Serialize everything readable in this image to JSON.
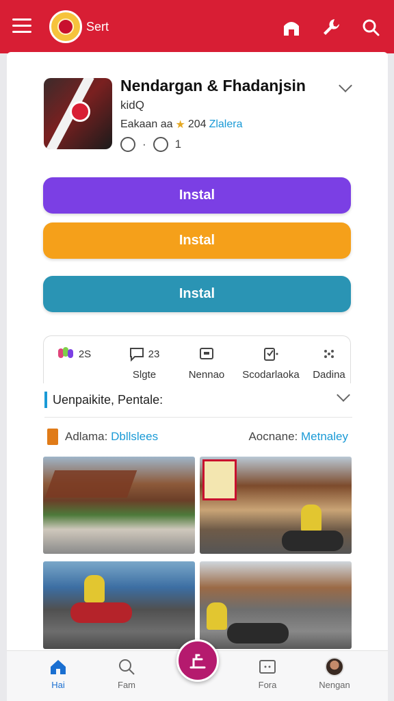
{
  "header": {
    "brand": "Sert",
    "icons": [
      "menu-icon",
      "emblem-logo",
      "home-icon",
      "wrench-icon",
      "search-icon"
    ]
  },
  "app": {
    "title": "Nendargan & Fhadanjsin",
    "subtitle": "kidQ",
    "meta_prefix": "Eakaan aa",
    "meta_count": "204",
    "meta_link": "Zlalera",
    "likes": "1"
  },
  "buttons": [
    {
      "label": "Instal",
      "color": "#7b3fe4"
    },
    {
      "label": "Instal",
      "color": "#f5a01a"
    },
    {
      "label": "Instal",
      "color": "#2a94b4"
    }
  ],
  "stats": [
    {
      "value": "2S",
      "label": "",
      "icon": "app-colors-icon"
    },
    {
      "value": "23",
      "label": "Slgte",
      "icon": "chat-icon"
    },
    {
      "value": "",
      "label": "Nennao",
      "icon": "tv-icon"
    },
    {
      "value": "",
      "label": "Scodarlaoka",
      "icon": "clipboard-icon"
    },
    {
      "value": "",
      "label": "Dadina",
      "icon": "dots-icon"
    }
  ],
  "section": {
    "title": "Uenpaikite, Pentale:"
  },
  "filters": {
    "left_label": "Adlama:",
    "left_value": "Dbllslees",
    "right_label": "Aocnane:",
    "right_value": "Metnaley"
  },
  "nav": [
    {
      "label": "Hai",
      "icon": "home-icon",
      "active": true
    },
    {
      "label": "Fam",
      "icon": "search-icon",
      "active": false
    },
    {
      "label": "Fora",
      "icon": "screen-icon",
      "active": false
    },
    {
      "label": "Nengan",
      "icon": "avatar",
      "active": false
    }
  ],
  "colors": {
    "primary_red": "#d81e34",
    "link_blue": "#1a9ad6",
    "fab": "#b51a6e"
  }
}
